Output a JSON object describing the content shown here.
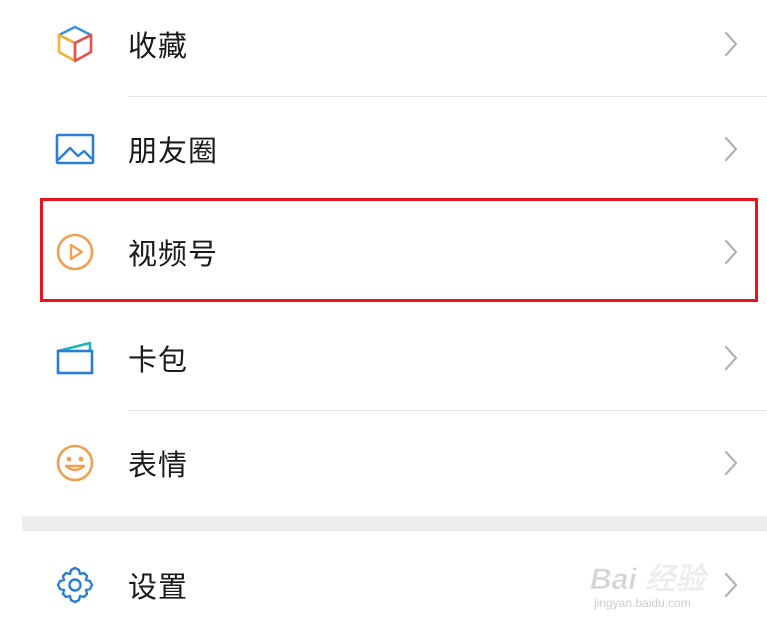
{
  "menu": {
    "items": [
      {
        "label": "收藏",
        "icon": "favorites-cube-icon"
      },
      {
        "label": "朋友圈",
        "icon": "moments-image-icon"
      },
      {
        "label": "视频号",
        "icon": "channels-play-icon"
      },
      {
        "label": "卡包",
        "icon": "card-wallet-icon"
      },
      {
        "label": "表情",
        "icon": "sticker-smile-icon"
      }
    ],
    "settings": {
      "label": "设置",
      "icon": "settings-gear-icon"
    }
  },
  "watermark": {
    "main": "Bai 经验",
    "sub": "jingyan.baidu.com"
  },
  "colors": {
    "highlight": "#e8141b",
    "chevron": "#b3b3b3",
    "text": "#1a1a1a",
    "moments_blue": "#2a7fd4",
    "channels_orange": "#f0a050",
    "wallet_teal": "#1fb5b0",
    "settings_blue": "#2a7fd4"
  }
}
